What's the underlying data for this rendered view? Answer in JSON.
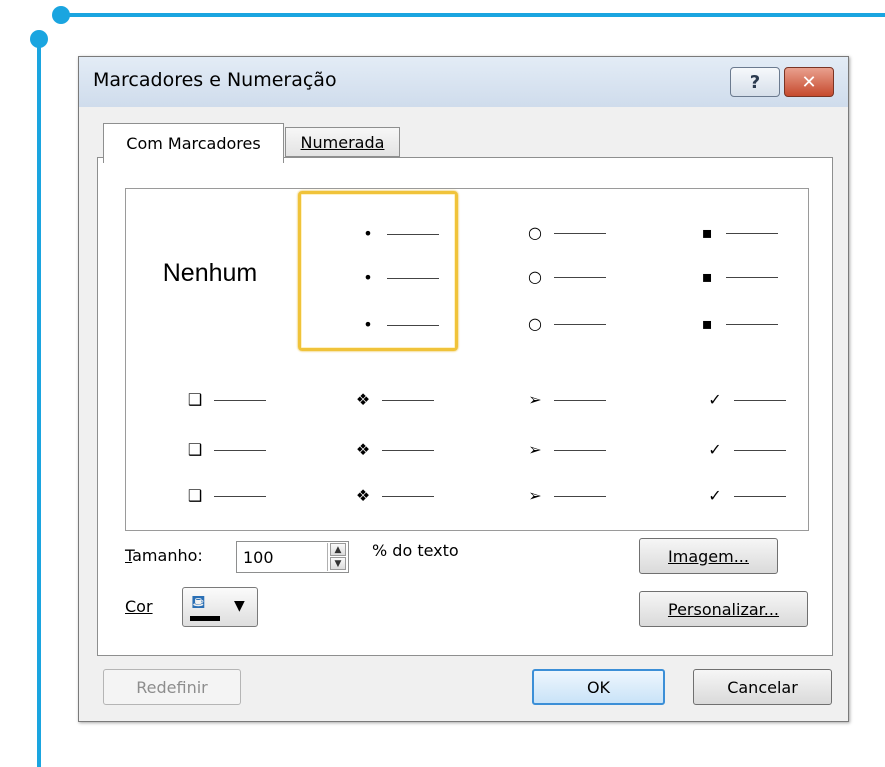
{
  "dialog": {
    "title": "Marcadores e Numeração",
    "help_glyph": "?",
    "close_glyph": "✕"
  },
  "tabs": [
    {
      "label": "Com Marcadores",
      "active": true
    },
    {
      "label": "Numerada",
      "active": false
    }
  ],
  "gallery": {
    "none_label": "Nenhum",
    "selected": "bullet-dot",
    "row1": [
      {
        "name": "bullet-dot",
        "symbol": "•"
      },
      {
        "name": "bullet-hollow-circle",
        "symbol": "○"
      },
      {
        "name": "bullet-filled-square",
        "symbol": "▪"
      }
    ],
    "row2": [
      {
        "name": "bullet-hollow-square",
        "symbol": "❑"
      },
      {
        "name": "bullet-diamond-star",
        "symbol": "❖"
      },
      {
        "name": "bullet-arrowhead",
        "symbol": "➢"
      },
      {
        "name": "bullet-checkmark",
        "symbol": "✓"
      }
    ]
  },
  "size": {
    "label": "Tamanho:",
    "value": "100",
    "suffix": "% do texto"
  },
  "color": {
    "label": "Cor",
    "swatch": "#000000"
  },
  "buttons": {
    "image": "Imagem...",
    "customize": "Personalizar...",
    "reset": "Redefinir",
    "ok": "OK",
    "cancel": "Cancelar"
  },
  "colors": {
    "accent_line": "#1aa5e0",
    "selection": "#f0c33a"
  }
}
